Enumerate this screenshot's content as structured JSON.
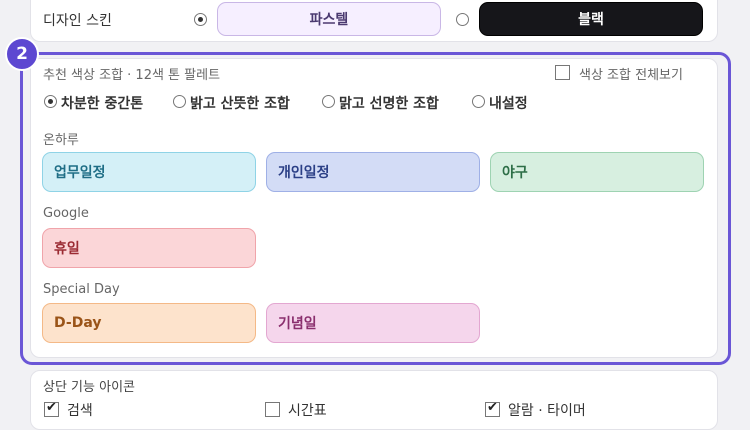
{
  "skin": {
    "label": "디자인 스킨",
    "options": [
      {
        "label": "파스텔",
        "selected": true
      },
      {
        "label": "블랙",
        "selected": false
      }
    ]
  },
  "step_badge": "2",
  "palette": {
    "title": "추천 색상 조합 · 12색 톤 팔레트",
    "view_all_label": "색상 조합 전체보기",
    "view_all_checked": false,
    "tone_options": [
      {
        "label": "차분한 중간톤",
        "selected": true
      },
      {
        "label": "밝고 산뜻한 조합",
        "selected": false
      },
      {
        "label": "맑고 선명한 조합",
        "selected": false
      },
      {
        "label": "내설정",
        "selected": false
      }
    ],
    "groups": [
      {
        "label": "온하루",
        "tags": [
          {
            "label": "업무일정",
            "bg": "#d4f0f7",
            "border": "#8fd3e6",
            "color": "#1f6e86"
          },
          {
            "label": "개인일정",
            "bg": "#d3dcf6",
            "border": "#9fb0e6",
            "color": "#2b3f86"
          },
          {
            "label": "야구",
            "bg": "#d7efe0",
            "border": "#9ed3b2",
            "color": "#2d6e47"
          }
        ]
      },
      {
        "label": "Google",
        "tags": [
          {
            "label": "휴일",
            "bg": "#fbd6d8",
            "border": "#f0a4aa",
            "color": "#9b2b33"
          }
        ]
      },
      {
        "label": "Special Day",
        "tags": [
          {
            "label": "D-Day",
            "bg": "#fde3cc",
            "border": "#f4b987",
            "color": "#9a5418"
          },
          {
            "label": "기념일",
            "bg": "#f5d6ec",
            "border": "#e3a7d1",
            "color": "#8a2f6e"
          }
        ]
      }
    ]
  },
  "top_icons": {
    "title": "상단 기능 아이콘",
    "items": [
      {
        "label": "검색",
        "checked": true
      },
      {
        "label": "시간표",
        "checked": false
      },
      {
        "label": "알람 · 타이머",
        "checked": true
      }
    ]
  },
  "colors": {
    "highlight": "#6a56d6",
    "badge": "#5d48d1"
  }
}
